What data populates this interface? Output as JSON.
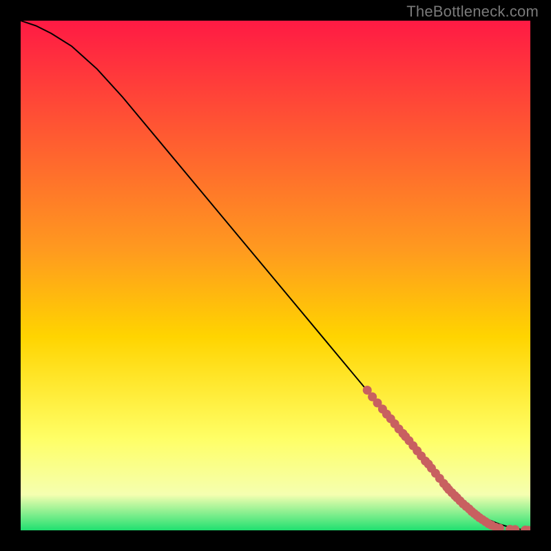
{
  "watermark": "TheBottleneck.com",
  "palette": {
    "top_color": "#ff1a44",
    "mid_color": "#ffd400",
    "bottom_color": "#20e070",
    "curve_color": "#000000",
    "dot_color": "#c86060",
    "bg": "#000000"
  },
  "chart_data": {
    "type": "line",
    "title": "",
    "xlabel": "",
    "ylabel": "",
    "xlim": [
      0,
      100
    ],
    "ylim": [
      0,
      100
    ],
    "series": [
      {
        "name": "curve",
        "x": [
          0,
          3,
          6,
          10,
          15,
          20,
          30,
          40,
          50,
          60,
          70,
          75,
          80,
          84,
          86,
          88,
          90,
          92,
          94,
          96,
          98,
          100
        ],
        "y": [
          100,
          99,
          97.5,
          95,
          90.5,
          85,
          73,
          61,
          49,
          37,
          25,
          19,
          13,
          8,
          6,
          4.5,
          3,
          2,
          1.2,
          0.6,
          0.2,
          0
        ]
      }
    ],
    "dots": {
      "name": "markers",
      "points": [
        {
          "x": 68,
          "y": 27.5
        },
        {
          "x": 69,
          "y": 26.2
        },
        {
          "x": 70,
          "y": 25.0
        },
        {
          "x": 71,
          "y": 23.8
        },
        {
          "x": 71.8,
          "y": 22.8
        },
        {
          "x": 72.6,
          "y": 21.9
        },
        {
          "x": 73.4,
          "y": 20.9
        },
        {
          "x": 74.2,
          "y": 19.9
        },
        {
          "x": 75.0,
          "y": 19.0
        },
        {
          "x": 75.5,
          "y": 18.4
        },
        {
          "x": 76.2,
          "y": 17.6
        },
        {
          "x": 77.0,
          "y": 16.6
        },
        {
          "x": 77.8,
          "y": 15.6
        },
        {
          "x": 78.6,
          "y": 14.6
        },
        {
          "x": 79.4,
          "y": 13.6
        },
        {
          "x": 80.0,
          "y": 13.0
        },
        {
          "x": 80.6,
          "y": 12.2
        },
        {
          "x": 81.4,
          "y": 11.2
        },
        {
          "x": 82.2,
          "y": 10.2
        },
        {
          "x": 83.0,
          "y": 9.2
        },
        {
          "x": 83.6,
          "y": 8.5
        },
        {
          "x": 84.0,
          "y": 8.0
        },
        {
          "x": 84.6,
          "y": 7.4
        },
        {
          "x": 85.2,
          "y": 6.8
        },
        {
          "x": 85.6,
          "y": 6.4
        },
        {
          "x": 86.2,
          "y": 5.8
        },
        {
          "x": 86.8,
          "y": 5.2
        },
        {
          "x": 87.4,
          "y": 4.7
        },
        {
          "x": 88.0,
          "y": 4.2
        },
        {
          "x": 88.5,
          "y": 3.7
        },
        {
          "x": 89.0,
          "y": 3.3
        },
        {
          "x": 89.5,
          "y": 2.9
        },
        {
          "x": 90.0,
          "y": 2.5
        },
        {
          "x": 90.6,
          "y": 2.1
        },
        {
          "x": 91.2,
          "y": 1.7
        },
        {
          "x": 91.8,
          "y": 1.3
        },
        {
          "x": 92.4,
          "y": 1.0
        },
        {
          "x": 93.2,
          "y": 0.6
        },
        {
          "x": 94.0,
          "y": 0.4
        },
        {
          "x": 96.0,
          "y": 0.2
        },
        {
          "x": 97.0,
          "y": 0.15
        },
        {
          "x": 99.0,
          "y": 0.05
        },
        {
          "x": 99.6,
          "y": 0.0
        }
      ]
    }
  }
}
